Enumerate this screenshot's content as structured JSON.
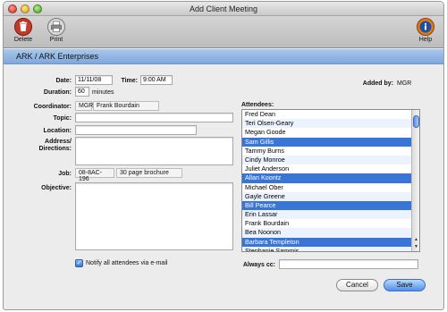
{
  "window": {
    "title": "Add Client Meeting"
  },
  "toolbar": {
    "delete_label": "Delete",
    "print_label": "Print",
    "help_label": "Help"
  },
  "header": {
    "title": "ARK / ARK Enterprises"
  },
  "form": {
    "date_label": "Date:",
    "date_value": "11/11/08",
    "time_label": "Time:",
    "time_value": "9:00 AM",
    "duration_label": "Duration:",
    "duration_value": "60",
    "duration_unit": "minutes",
    "added_by_label": "Added by:",
    "added_by_value": "MGR",
    "coordinator_label": "Coordinator:",
    "coordinator_code": "MGR",
    "coordinator_name": "Frank Bourdain",
    "topic_label": "Topic:",
    "topic_value": "",
    "location_label": "Location:",
    "location_value": "",
    "address_label_1": "Address/",
    "address_label_2": "Directions:",
    "address_value": "",
    "job_label": "Job:",
    "job_code": "08-8AC-196",
    "job_name": "30 page brochure",
    "objective_label": "Objective:",
    "objective_value": "",
    "notify_label": "Notify all attendees via e-mail",
    "always_cc_label": "Always cc:",
    "always_cc_value": ""
  },
  "attendees": {
    "label": "Attendees:",
    "items": [
      {
        "name": "Fred Dean",
        "selected": false
      },
      {
        "name": "Teri Olsen-Geary",
        "selected": false
      },
      {
        "name": "Megan Goode",
        "selected": false
      },
      {
        "name": "Sam Gillis",
        "selected": true
      },
      {
        "name": "Tammy Burns",
        "selected": false
      },
      {
        "name": "Cindy Monroe",
        "selected": false
      },
      {
        "name": "Juliet Anderson",
        "selected": false
      },
      {
        "name": "Allan Koontz",
        "selected": true
      },
      {
        "name": "Michael Ober",
        "selected": false
      },
      {
        "name": "Gayle Greene",
        "selected": false
      },
      {
        "name": "Bill Pearce",
        "selected": true
      },
      {
        "name": "Erin Lassar",
        "selected": false
      },
      {
        "name": "Frank Bourdain",
        "selected": false
      },
      {
        "name": "Bea Noonon",
        "selected": false
      },
      {
        "name": "Barbara Templeton",
        "selected": true
      },
      {
        "name": "Stephanie Sammis",
        "selected": false
      }
    ]
  },
  "buttons": {
    "cancel_label": "Cancel",
    "save_label": "Save"
  },
  "colors": {
    "selection": "#3875d7",
    "header_band": "#8fb3e2",
    "primary_button": "#4d92ea"
  }
}
